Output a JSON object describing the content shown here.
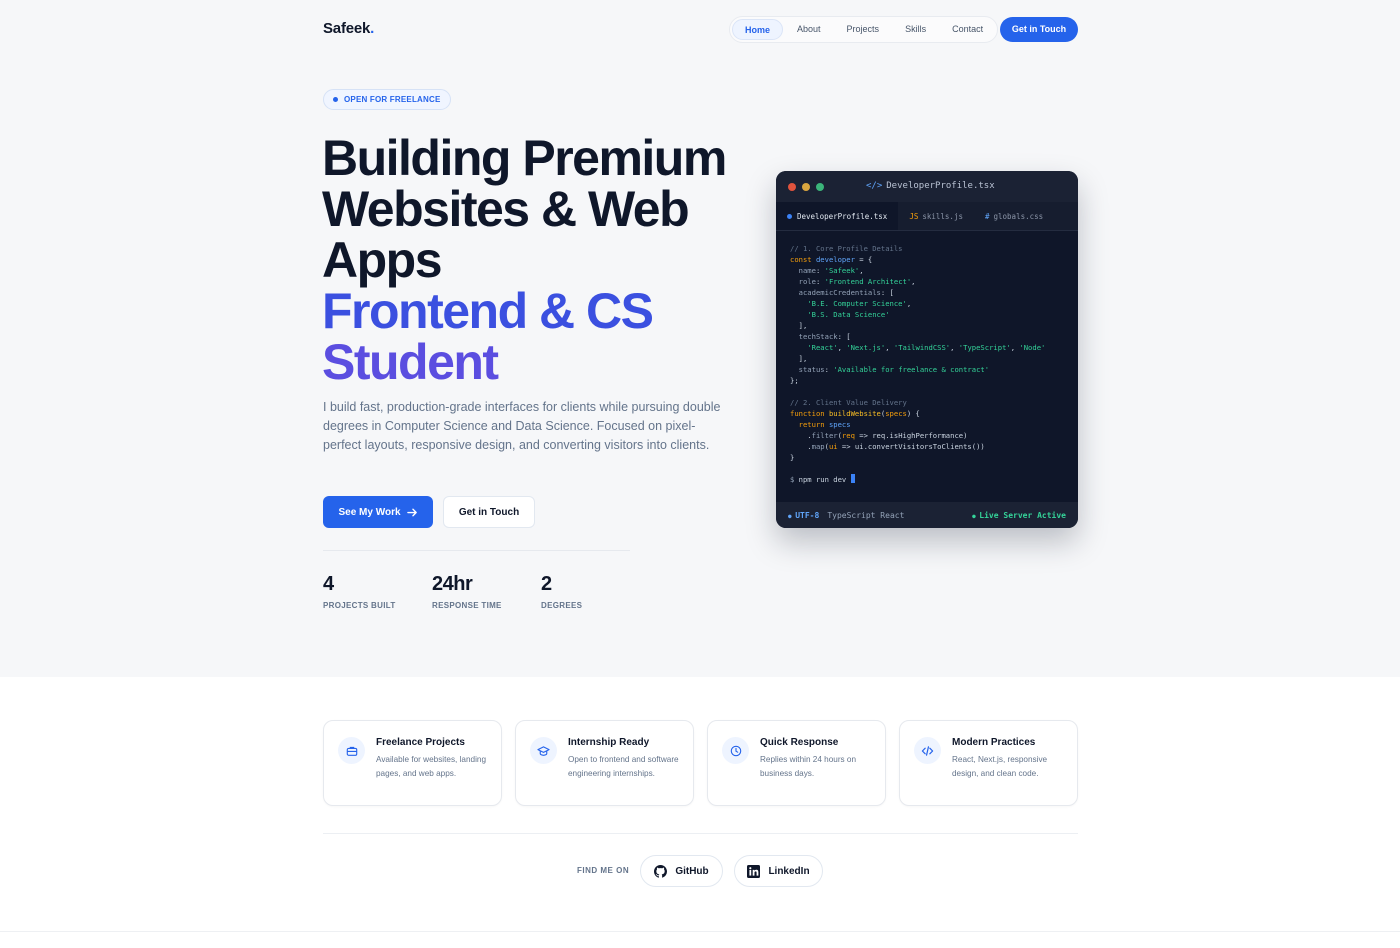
{
  "nav": {
    "logo": "Safeek",
    "logo_dot": ".",
    "links": [
      "Home",
      "About",
      "Projects",
      "Skills",
      "Contact"
    ],
    "active": "Home",
    "cta": "Get in Touch"
  },
  "hero": {
    "badge": "OPEN FOR FREELANCE",
    "title_lines": [
      "Building Premium",
      "Websites & Web",
      "Apps"
    ],
    "highlight_lines": [
      "Frontend & CS",
      "Student"
    ],
    "lead": "I build fast, production-grade interfaces for clients while pursuing double degrees in Computer Science and Data Science. Focused on pixel-perfect layouts, responsive design, and converting visitors into clients.",
    "primary_cta": "See My Work",
    "secondary_cta": "Get in Touch",
    "stats": [
      {
        "value": "4",
        "label": "PROJECTS BUILT"
      },
      {
        "value": "24hr",
        "label": "RESPONSE TIME"
      },
      {
        "value": "2",
        "label": "DEGREES"
      }
    ]
  },
  "editor": {
    "filename": "DeveloperProfile.tsx",
    "tabs": [
      {
        "label": "DeveloperProfile.tsx",
        "icon": "dot"
      },
      {
        "label": "skills.js",
        "icon": "JS"
      },
      {
        "label": "globals.css",
        "icon": "#"
      }
    ],
    "status_encoding": "UTF-8",
    "status_language": "TypeScript React",
    "status_live": "Live Server Active",
    "colors": {
      "red": "#e0533d",
      "amber": "#d9a53f",
      "green": "#3bb57a"
    }
  },
  "features": [
    {
      "title": "Freelance Projects",
      "desc": "Available for websites, landing pages, and web apps.",
      "icon": "briefcase-icon"
    },
    {
      "title": "Internship Ready",
      "desc": "Open to frontend and software engineering internships.",
      "icon": "graduation-cap-icon"
    },
    {
      "title": "Quick Response",
      "desc": "Replies within 24 hours on business days.",
      "icon": "clock-icon"
    },
    {
      "title": "Modern Practices",
      "desc": "React, Next.js, responsive design, and clean code.",
      "icon": "code-icon"
    }
  ],
  "social": {
    "label": "FIND ME ON",
    "links": [
      "GitHub",
      "LinkedIn"
    ]
  },
  "accent": "#2563eb"
}
